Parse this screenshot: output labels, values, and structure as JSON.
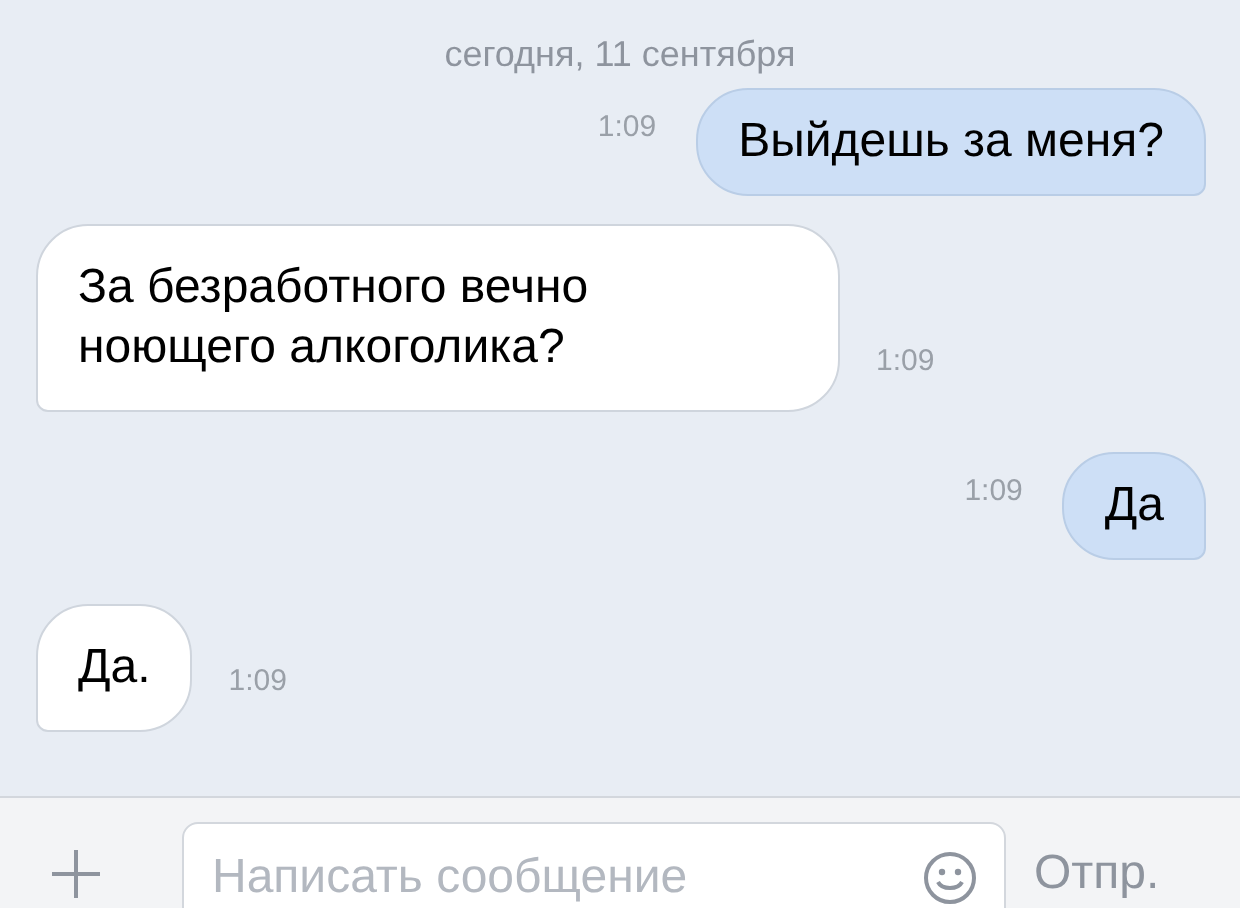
{
  "date_header": "сегодня, 11 сентября",
  "messages": [
    {
      "kind": "outgoing",
      "text": "Выйдешь за меня?",
      "time": "1:09"
    },
    {
      "kind": "incoming",
      "text": "За безработного вечно ноющего алкоголика?",
      "time": "1:09"
    },
    {
      "kind": "outgoing",
      "text": "Да",
      "time": "1:09"
    },
    {
      "kind": "incoming",
      "text": "Да.",
      "time": "1:09"
    }
  ],
  "composer": {
    "placeholder": "Написать сообщение",
    "send_label": "Отпр."
  }
}
